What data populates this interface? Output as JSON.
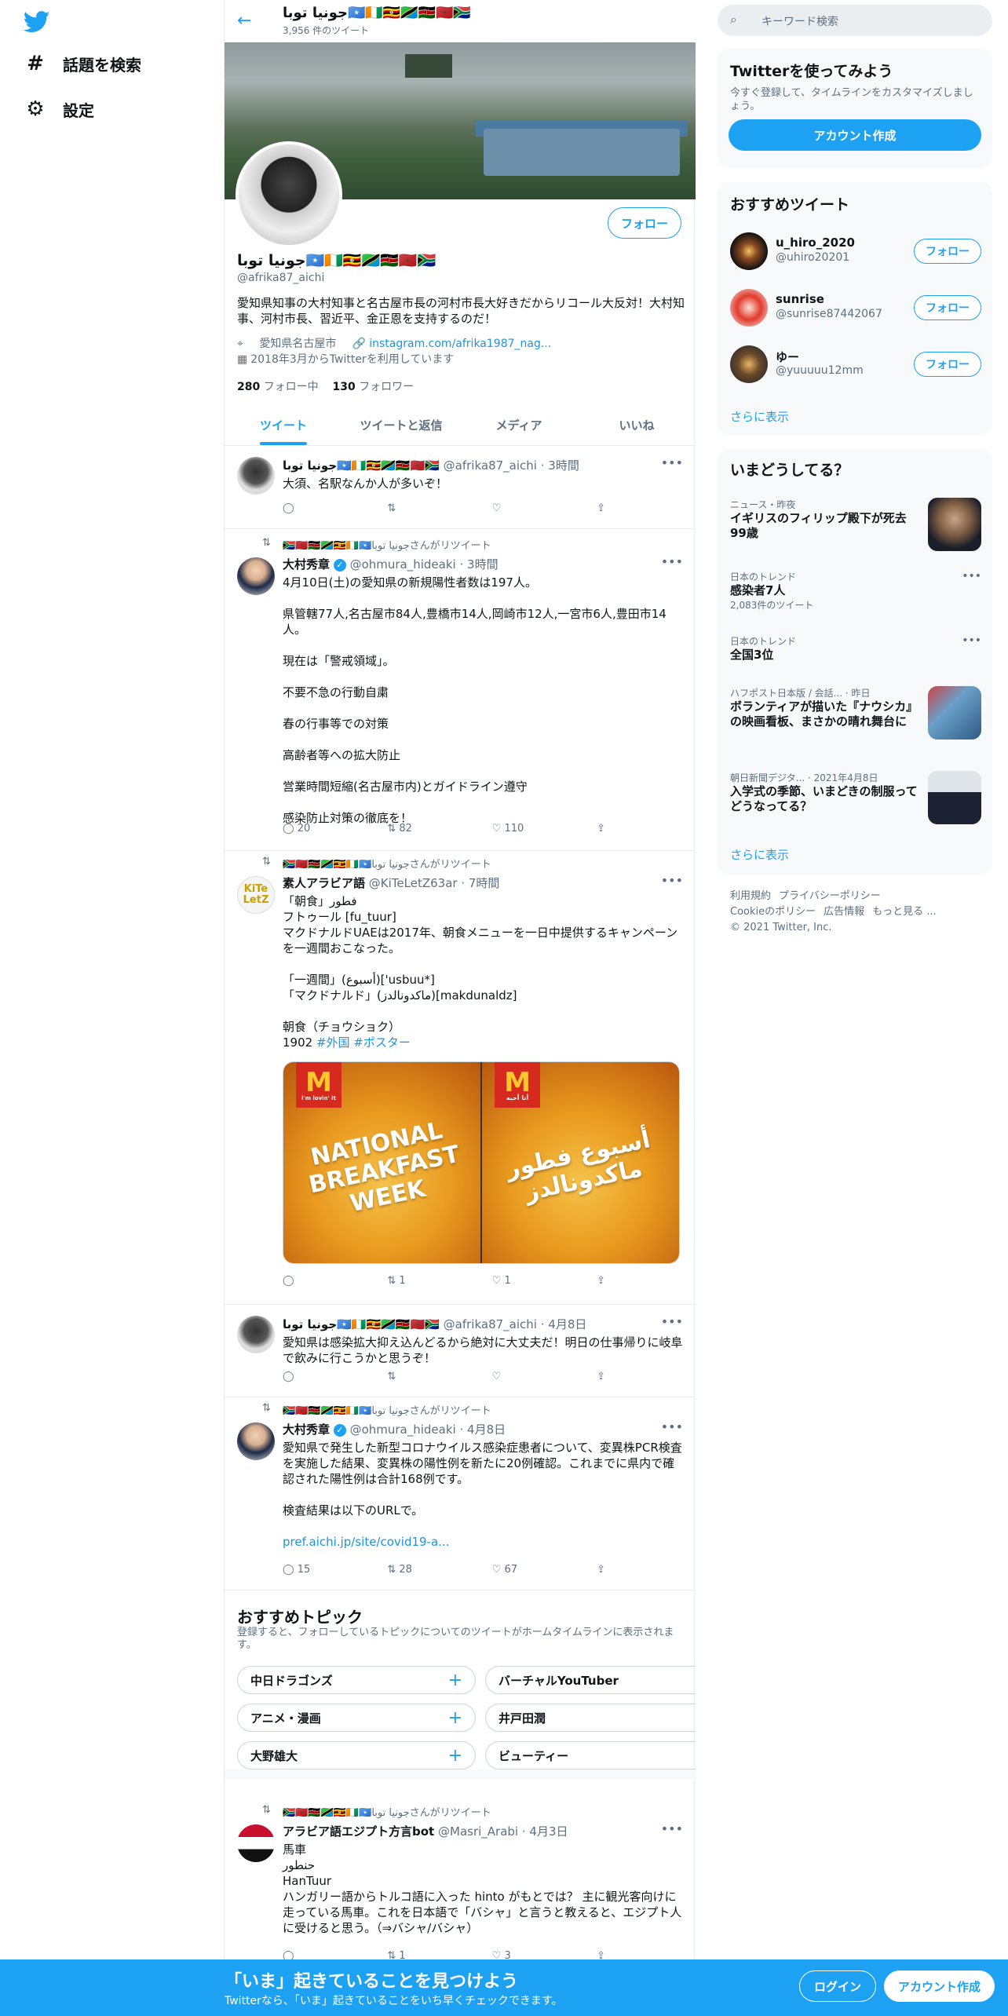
{
  "nav": {
    "explore_label": "話題を検索",
    "settings_label": "設定"
  },
  "profile": {
    "name": "جونيا توبا🇸🇴🇨🇮🇺🇬🇹🇿🇰🇪🇲🇦🇿🇦",
    "tweet_count": "3,956 件のツイート",
    "follow_label": "フォロー",
    "handle": "@afrika87_aichi",
    "bio": "愛知県知事の大村知事と名古屋市長の河村市長大好きだからリコール大反対！大村知事、河村市長、習近平、金正恩を支持するのだ！",
    "location": "愛知県名古屋市",
    "link": "instagram.com/afrika1987_nag...",
    "joined": "2018年3月からTwitterを利用しています",
    "following_num": "280",
    "following_label": "フォロー中",
    "followers_num": "130",
    "followers_label": "フォロワー"
  },
  "tabs": [
    "ツイート",
    "ツイートと返信",
    "メディア",
    "いいね"
  ],
  "tweets": [
    {
      "retweet_line": "",
      "name": "جونيا توبا🇸🇴🇨🇮🇺🇬🇹🇿🇰🇪🇲🇦🇿🇦",
      "handle": "@afrika87_aichi",
      "time": "3時間",
      "text": "大須、名駅なんか人が多いぞ！",
      "replies": "",
      "retweets": "",
      "likes": ""
    },
    {
      "retweet_line": "🇿🇦🇲🇦🇰🇪🇹🇿🇺🇬🇨🇮🇸🇴جونيا توباさんがリツイート",
      "name": "大村秀章",
      "handle": "@ohmura_hideaki",
      "time": "3時間",
      "text": "4月10日(土)の愛知県の新規陽性者数は197人。\n\n県管轄77人,名古屋市84人,豊橋市14人,岡崎市12人,一宮市6人,豊田市14人。\n\n現在は「警戒領域」。\n\n不要不急の行動自粛\n\n春の行事等での対策\n\n高齢者等への拡大防止\n\n営業時間短縮(名古屋市内)とガイドライン遵守\n\n感染防止対策の徹底を！",
      "replies": "20",
      "retweets": "82",
      "likes": "110"
    },
    {
      "retweet_line": "🇿🇦🇲🇦🇰🇪🇹🇿🇺🇬🇨🇮🇸🇴جونيا توباさんがリツイート",
      "name": "素人アラビア語",
      "handle": "@KiTeLetZ63ar",
      "time": "7時間",
      "text": "「朝食」فطور\nフトゥール [fu_tuur]\nマクドナルドUAEは2017年、朝食メニューを一日中提供するキャンペーンを一週間おこなった。\n\n「一週間」(أسبوع)['usbuu*]\n「マクドナルド」(ماكدونالدز)[makdunaldz]\n\n朝食（チョウショク）\n1902 ",
      "hashtags": "#外国 #ポスター",
      "media_left": "NATIONAL BREAKFAST WEEK",
      "media_right": "أسبوع فطور ماكدونالدز",
      "media_left_tag": "i'm lovin' it",
      "media_right_tag": "أنا أحبه",
      "replies": "",
      "retweets": "1",
      "likes": "1"
    },
    {
      "retweet_line": "",
      "name": "جونيا توبا🇸🇴🇨🇮🇺🇬🇹🇿🇰🇪🇲🇦🇿🇦",
      "handle": "@afrika87_aichi",
      "time": "4月8日",
      "text": "愛知県は感染拡大抑え込んどるから絶対に大丈夫だ！明日の仕事帰りに岐阜で飲みに行こうかと思うぞ！",
      "replies": "",
      "retweets": "",
      "likes": ""
    },
    {
      "retweet_line": "🇿🇦🇲🇦🇰🇪🇹🇿🇺🇬🇨🇮🇸🇴جونيا توباさんがリツイート",
      "name": "大村秀章",
      "handle": "@ohmura_hideaki",
      "time": "4月8日",
      "text": "愛知県で発生した新型コロナウイルス感染症患者について、変異株PCR検査を実施した結果、変異株の陽性例を新たに20例確認。これまでに県内で確認された陽性例は合計168例です。\n\n検査結果は以下のURLで。\n\n",
      "link": "pref.aichi.jp/site/covid19-a...",
      "replies": "15",
      "retweets": "28",
      "likes": "67"
    },
    {
      "retweet_line": "🇿🇦🇲🇦🇰🇪🇹🇿🇺🇬🇨🇮🇸🇴جونيا توباさんがリツイート",
      "name": "アラビア語エジプト方言bot",
      "handle": "@Masri_Arabi",
      "time": "4月3日",
      "text": "馬車\nحنطور\nHanTuur\nハンガリー語からトルコ語に入った hinto がもとでは？ 主に観光客向けに走っている馬車。これを日本語で「バシャ」と言うと教えると、エジプト人に受けると思う。（⇒バシャ/バシャ）",
      "replies": "",
      "retweets": "1",
      "likes": "3"
    }
  ],
  "topics": {
    "title": "おすすめトピック",
    "subtitle": "登録すると、フォローしているトピックについてのツイートがホームタイムラインに表示されます。",
    "left": [
      "中日ドラゴンズ",
      "アニメ・漫画",
      "大野雄大"
    ],
    "right": [
      "バーチャルYouTuber",
      "井戸田潤",
      "ビューティー"
    ]
  },
  "sidebar": {
    "search_placeholder": "キーワード検索",
    "signup": {
      "title": "Twitterを使ってみよう",
      "desc": "今すぐ登録して、タイムラインをカスタマイズしましょう。",
      "button": "アカウント作成"
    },
    "recommend": {
      "title": "おすすめツイート",
      "follow_label": "フォロー",
      "users": [
        {
          "name": "u_hiro_2020",
          "handle": "@uhiro20201"
        },
        {
          "name": "sunrise",
          "handle": "@sunrise87442067"
        },
        {
          "name": "ゆー",
          "handle": "@yuuuuu12mm"
        }
      ],
      "more": "さらに表示"
    },
    "trends": {
      "title": "いまどうしてる？",
      "items": [
        {
          "context": "ニュース・昨夜",
          "title": "イギリスのフィリップ殿下が死去 99歳",
          "sub": ""
        },
        {
          "context": "日本のトレンド",
          "title": "感染者7人",
          "sub": "2,083件のツイート"
        },
        {
          "context": "日本のトレンド",
          "title": "全国3位",
          "sub": ""
        },
        {
          "context": "ハフポスト日本版 / 会話... · 昨日",
          "title": "ボランティアが描いた『ナウシカ』の映画看板、まさかの晴れ舞台に",
          "sub": ""
        },
        {
          "context": "朝日新聞デジタ... · 2021年4月8日",
          "title": "入学式の季節、いまどきの制服ってどうなってる？",
          "sub": ""
        }
      ],
      "more": "さらに表示"
    },
    "footer": [
      "利用規約",
      "プライバシーポリシー",
      "Cookieのポリシー",
      "広告情報",
      "もっと見る ...",
      "© 2021 Twitter, Inc."
    ]
  },
  "bottombar": {
    "title": "「いま」起きていることを見つけよう",
    "subtitle": "Twitterなら、「いま」起きていることをいち早くチェックできます。",
    "login": "ログイン",
    "signup": "アカウント作成"
  },
  "colors": {
    "accent": "#1da1f2",
    "text_secondary": "#5b7083"
  }
}
